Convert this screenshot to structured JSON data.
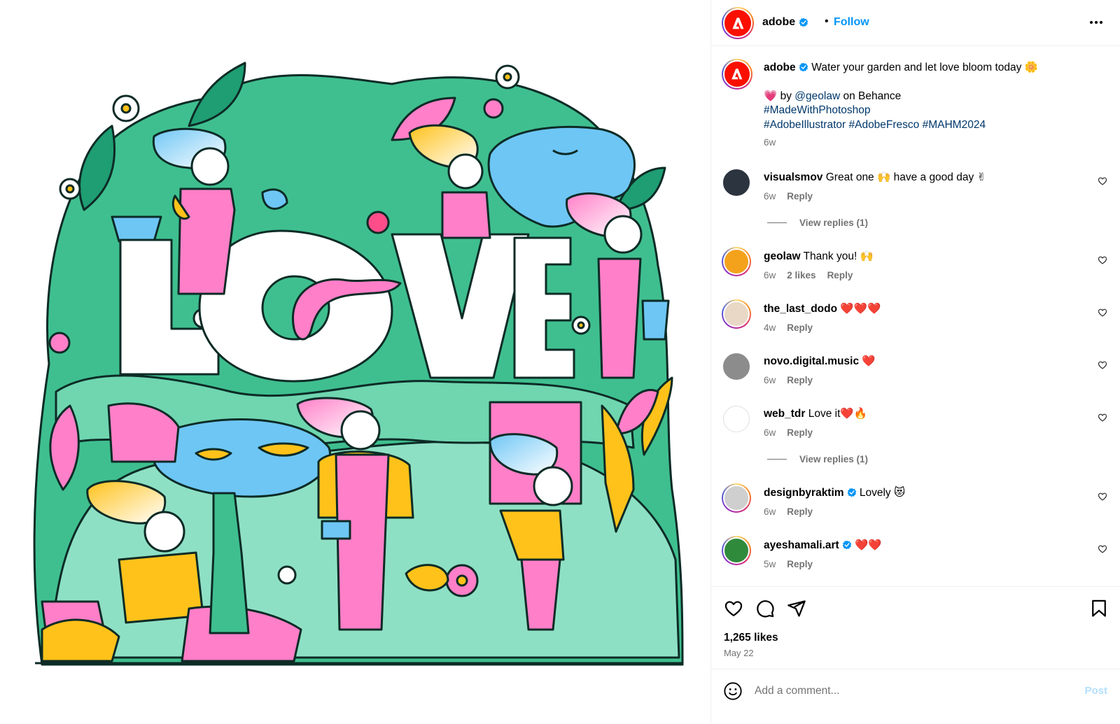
{
  "header": {
    "username": "adobe",
    "separator": "•",
    "follow_label": "Follow",
    "more_icon": "more-horizontal-icon"
  },
  "media": {
    "artwork_word": "LOVE",
    "colors": {
      "green": "#3fbf8f",
      "mint": "#8ee0c4",
      "pink": "#ff7fc8",
      "yellow": "#ffc21a",
      "blue": "#6ec6f5",
      "outline": "#0d2b26"
    }
  },
  "caption": {
    "username": "adobe",
    "text": "Water your garden and let love bloom today 🌼",
    "line2_prefix": "💗 by ",
    "mention": "@geolaw",
    "line2_suffix": " on Behance",
    "hashtag_line1": "#MadeWithPhotoshop",
    "hashtag_line2": "#AdobeIllustrator #AdobeFresco #MAHM2024",
    "time": "6w"
  },
  "comments": [
    {
      "username": "visualsmov",
      "text": "Great one 🙌 have a good day ✌",
      "time": "6w",
      "likes": "",
      "reply": "Reply",
      "view_replies": "View replies (1)",
      "avatar_color": "#2c3440",
      "verified": false,
      "ring": false
    },
    {
      "username": "geolaw",
      "text": "Thank you! 🙌",
      "time": "6w",
      "likes": "2 likes",
      "reply": "Reply",
      "view_replies": "",
      "avatar_color": "#f4a21c",
      "verified": false,
      "ring": true
    },
    {
      "username": "the_last_dodo",
      "text": "❤️❤️❤️",
      "time": "4w",
      "likes": "",
      "reply": "Reply",
      "view_replies": "",
      "avatar_color": "#e9d8c6",
      "verified": false,
      "ring": true
    },
    {
      "username": "novo.digital.music",
      "text": "❤️",
      "time": "6w",
      "likes": "",
      "reply": "Reply",
      "view_replies": "",
      "avatar_color": "#8c8c8c",
      "verified": false,
      "ring": false
    },
    {
      "username": "web_tdr",
      "text": "Love it❤️🔥",
      "time": "6w",
      "likes": "",
      "reply": "Reply",
      "view_replies": "View replies (1)",
      "avatar_color": "#ffffff",
      "verified": false,
      "ring": false
    },
    {
      "username": "designbyraktim",
      "text": "Lovely 😻",
      "time": "6w",
      "likes": "",
      "reply": "Reply",
      "view_replies": "",
      "avatar_color": "#cfcfcf",
      "verified": true,
      "ring": true
    },
    {
      "username": "ayeshamali.art",
      "text": "❤️❤️",
      "time": "5w",
      "likes": "",
      "reply": "Reply",
      "view_replies": "",
      "avatar_color": "#2f8a3c",
      "verified": true,
      "ring": true
    }
  ],
  "actions": {
    "likes": "1,265 likes",
    "date": "May 22"
  },
  "comment_bar": {
    "placeholder": "Add a comment...",
    "post_label": "Post"
  }
}
